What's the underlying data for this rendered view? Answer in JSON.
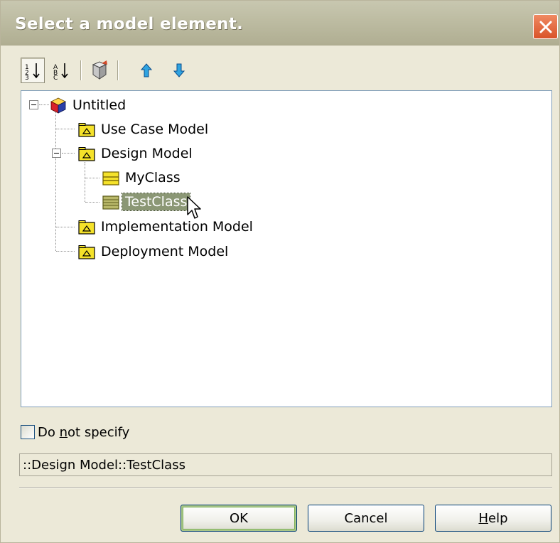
{
  "dialog": {
    "title": "Select a model element.",
    "toolbar": {
      "sort_numeric_tooltip": "",
      "buttons": [
        "sort-by-type-icon",
        "sort-alphabetical-icon",
        "filter-icon",
        "move-up-icon",
        "move-down-icon"
      ]
    },
    "tree": {
      "root": "Untitled",
      "items": [
        {
          "label": "Use Case Model",
          "icon": "package-icon"
        },
        {
          "label": "Design Model",
          "icon": "package-icon",
          "expanded": true,
          "children": [
            {
              "label": "MyClass",
              "icon": "class-icon"
            },
            {
              "label": "TestClass",
              "icon": "class-icon",
              "selected": true
            }
          ]
        },
        {
          "label": "Implementation Model",
          "icon": "package-icon"
        },
        {
          "label": "Deployment Model",
          "icon": "package-icon"
        }
      ]
    },
    "do_not_specify": {
      "label_pre": "Do ",
      "label_mnemonic": "n",
      "label_post": "ot specify",
      "checked": false
    },
    "selected_path": "::Design Model::TestClass",
    "buttons": {
      "ok": "OK",
      "cancel": "Cancel",
      "help_mnemonic": "H",
      "help_rest": "elp"
    },
    "colors": {
      "selection": "#8b9775",
      "title_gradient": "#bdbca2",
      "close": "#d9532a",
      "dialog_bg": "#ece9d8"
    }
  }
}
